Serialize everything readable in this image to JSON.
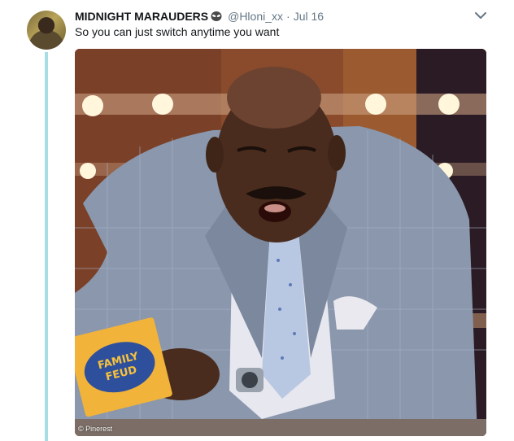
{
  "tweet": {
    "display_name": "MIDNIGHT MARAUDERS",
    "emoji_icon": "alien-emoji-icon",
    "handle": "@Hloni_xx",
    "separator": "·",
    "date": "Jul 16",
    "text": "So you can just switch anytime you want",
    "media": {
      "watermark": "© Pinerest",
      "card_text_line1": "FAMILY",
      "card_text_line2": "FEUD"
    }
  },
  "colors": {
    "thread_line": "#a8dde6",
    "name": "#14171a",
    "muted": "#657786"
  }
}
